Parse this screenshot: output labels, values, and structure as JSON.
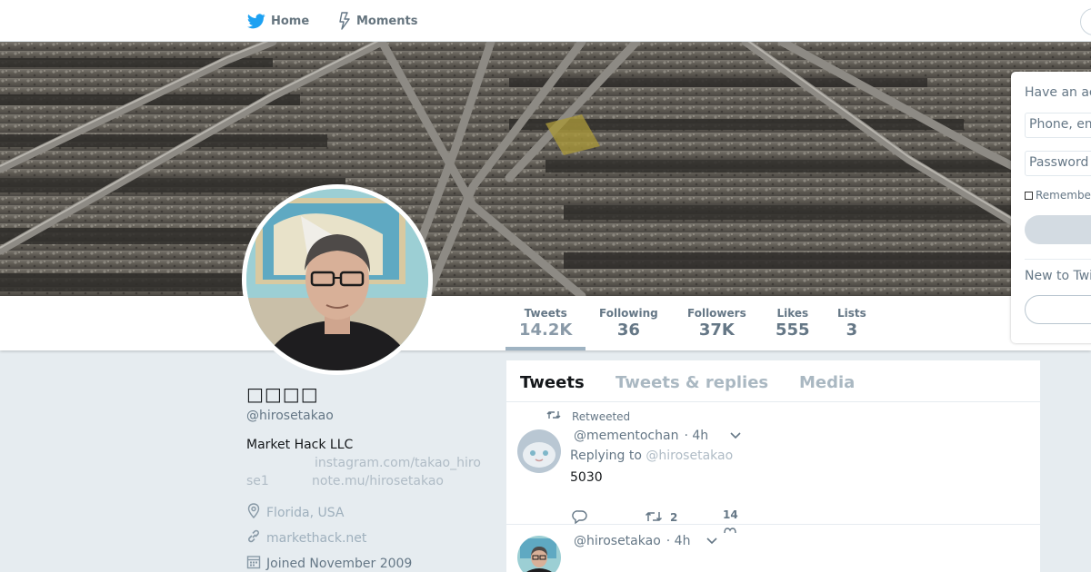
{
  "nav": {
    "home_label": "Home",
    "moments_label": "Moments"
  },
  "profile": {
    "name": "□□□□",
    "handle": "@hirosetakao",
    "bio": "Market Hack LLC",
    "bio_link_1_part1": "instagram.com/takao_hiro",
    "bio_link_1_part2": "se1",
    "bio_link_2": "note.mu/hirosetakao",
    "location": "Florida, USA",
    "url": "markethack.net",
    "joined": "Joined November 2009"
  },
  "stats": [
    {
      "label": "Tweets",
      "value": "14.2K"
    },
    {
      "label": "Following",
      "value": "36"
    },
    {
      "label": "Followers",
      "value": "37K"
    },
    {
      "label": "Likes",
      "value": "555"
    },
    {
      "label": "Lists",
      "value": "3"
    }
  ],
  "timeline": {
    "tabs": [
      "Tweets",
      "Tweets & replies",
      "Media"
    ],
    "tweets": [
      {
        "context": "Retweeted",
        "handle": "@mementochan",
        "time": "· 4h",
        "replying_prefix": "Replying to",
        "replying_to": "@hirosetakao",
        "text": "5030",
        "retweets": "2",
        "likes": "14"
      },
      {
        "handle": "@hirosetakao",
        "time": "· 4h"
      }
    ]
  },
  "login": {
    "title": "Have an account?",
    "phone_placeholder": "Phone, email or username",
    "password_placeholder": "Password",
    "remember": "Remember me",
    "new_to": "New to Twitter?"
  },
  "colors": {
    "brand": "#1da1f2",
    "link_muted": "#b0bcc6",
    "background": "#e6ecf0"
  }
}
